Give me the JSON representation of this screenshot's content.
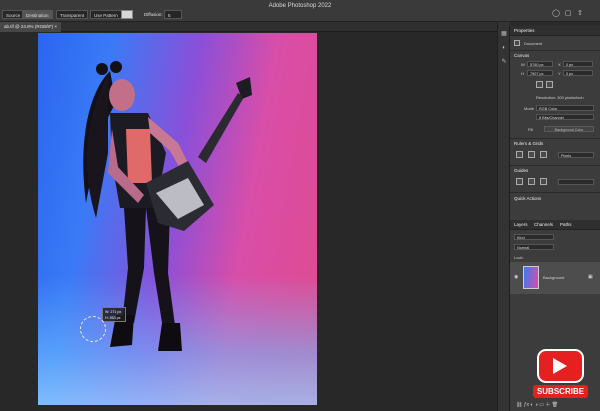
{
  "app": {
    "title": "Adobe Photoshop 2022"
  },
  "options": {
    "source_label": "Source",
    "destination_label": "Destination",
    "transparent_label": "Transparent",
    "use_pattern_label": "Use Pattern",
    "diffusion_label": "Diffusion:",
    "diffusion_value": "5"
  },
  "document": {
    "tab_label": "ab.tif @ 24.8% (RGB/8*)"
  },
  "canvas": {
    "hud_width": "W: 271 px",
    "hud_height": "H: 553 px"
  },
  "properties": {
    "tab_label": "Properties",
    "doc_label": "Document",
    "canvas_section": "Canvas",
    "w_label": "W",
    "w_value": "5760 px",
    "h_label": "H",
    "h_value": "7907 px",
    "x_label": "X",
    "x_value": "0 px",
    "y_label": "Y",
    "y_value": "0 px",
    "resolution": "Resolution: 300 pixels/inch",
    "mode_label": "Mode",
    "mode_value": "RGB Color",
    "bit_value": "8 Bits/Channel",
    "fill_label": "Fill",
    "fill_value": "Background Color",
    "rulers_section": "Rulers & Grids",
    "rulers_unit": "Pixels",
    "guides_section": "Guides",
    "quick_actions": "Quick Actions"
  },
  "layers": {
    "tabs": [
      "Layers",
      "Channels",
      "Paths"
    ],
    "kind_label": "Kind",
    "blend_label": "Normal",
    "lock_label": "Lock:",
    "layer_name": "Background"
  },
  "badge": {
    "label": "SUBSCRIBE"
  },
  "colors": {
    "accent_blue": "#2a66f0",
    "accent_pink": "#e14a8d",
    "youtube_red": "#e52020"
  }
}
